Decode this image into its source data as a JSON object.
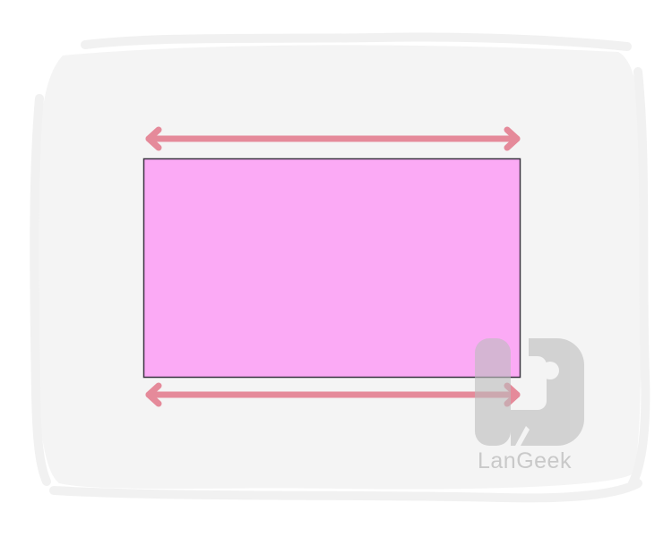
{
  "illustration": {
    "background_panel_color": "#f4f4f4",
    "rectangle_fill_color": "#fbaaf5",
    "rectangle_border_color": "#3a3340",
    "arrow_color": "#e58a9a",
    "top_arrow_icon": "double-headed-arrow-icon",
    "bottom_arrow_icon": "double-headed-arrow-icon"
  },
  "watermark": {
    "brand_text": "LanGeek",
    "logo_icon": "langeek-logo-icon",
    "color": "#c9c9c9"
  }
}
